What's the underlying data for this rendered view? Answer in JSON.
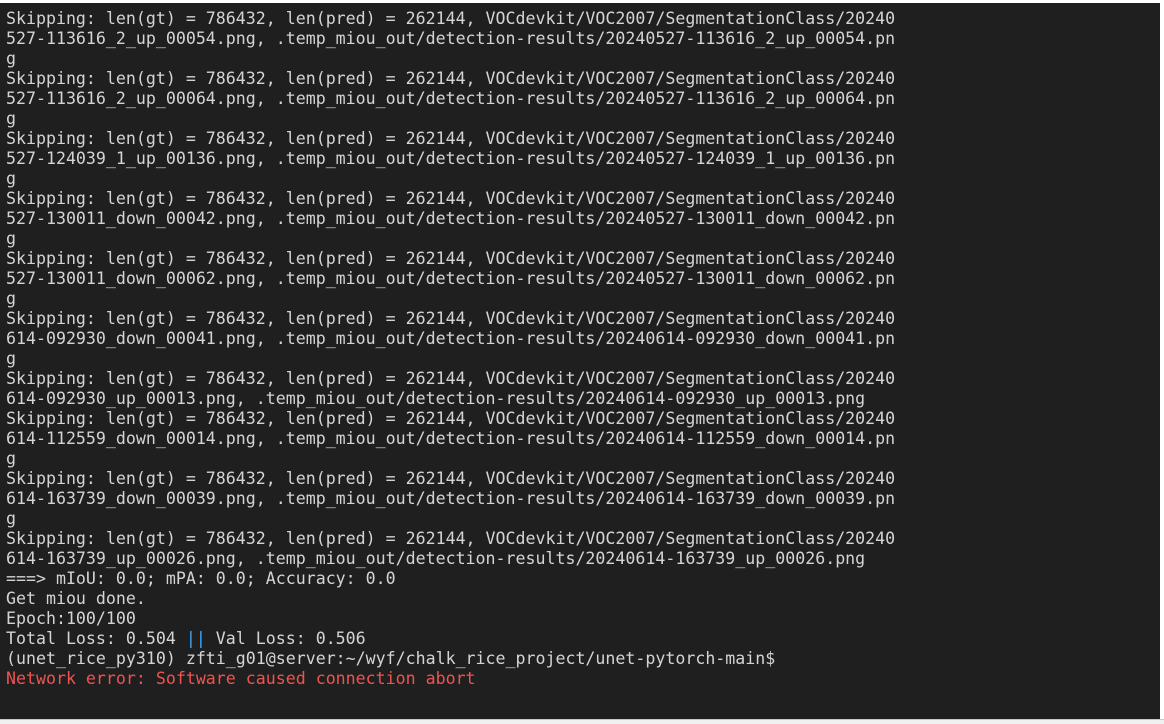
{
  "terminal": {
    "lines": [
      "Skipping: len(gt) = 786432, len(pred) = 262144, VOCdevkit/VOC2007/SegmentationClass/20240",
      "527-113616_2_up_00054.png, .temp_miou_out/detection-results/20240527-113616_2_up_00054.pn",
      "g",
      "Skipping: len(gt) = 786432, len(pred) = 262144, VOCdevkit/VOC2007/SegmentationClass/20240",
      "527-113616_2_up_00064.png, .temp_miou_out/detection-results/20240527-113616_2_up_00064.pn",
      "g",
      "Skipping: len(gt) = 786432, len(pred) = 262144, VOCdevkit/VOC2007/SegmentationClass/20240",
      "527-124039_1_up_00136.png, .temp_miou_out/detection-results/20240527-124039_1_up_00136.pn",
      "g",
      "Skipping: len(gt) = 786432, len(pred) = 262144, VOCdevkit/VOC2007/SegmentationClass/20240",
      "527-130011_down_00042.png, .temp_miou_out/detection-results/20240527-130011_down_00042.pn",
      "g",
      "Skipping: len(gt) = 786432, len(pred) = 262144, VOCdevkit/VOC2007/SegmentationClass/20240",
      "527-130011_down_00062.png, .temp_miou_out/detection-results/20240527-130011_down_00062.pn",
      "g",
      "Skipping: len(gt) = 786432, len(pred) = 262144, VOCdevkit/VOC2007/SegmentationClass/20240",
      "614-092930_down_00041.png, .temp_miou_out/detection-results/20240614-092930_down_00041.pn",
      "g",
      "Skipping: len(gt) = 786432, len(pred) = 262144, VOCdevkit/VOC2007/SegmentationClass/20240",
      "614-092930_up_00013.png, .temp_miou_out/detection-results/20240614-092930_up_00013.png",
      "Skipping: len(gt) = 786432, len(pred) = 262144, VOCdevkit/VOC2007/SegmentationClass/20240",
      "614-112559_down_00014.png, .temp_miou_out/detection-results/20240614-112559_down_00014.pn",
      "g",
      "Skipping: len(gt) = 786432, len(pred) = 262144, VOCdevkit/VOC2007/SegmentationClass/20240",
      "614-163739_down_00039.png, .temp_miou_out/detection-results/20240614-163739_down_00039.pn",
      "g",
      "Skipping: len(gt) = 786432, len(pred) = 262144, VOCdevkit/VOC2007/SegmentationClass/20240",
      "614-163739_up_00026.png, .temp_miou_out/detection-results/20240614-163739_up_00026.png",
      "===> mIoU: 0.0; mPA: 0.0; Accuracy: 0.0",
      "Get miou done.",
      "Epoch:100/100"
    ],
    "loss_line": {
      "total": "Total Loss: 0.504 ",
      "separator": "||",
      "val": " Val Loss: 0.506"
    },
    "prompt": "(unet_rice_py310) zfti_g01@server:~/wyf/chalk_rice_project/unet-pytorch-main$",
    "error": "Network error: Software caused connection abort",
    "colors": {
      "background": "#1f1f1f",
      "text": "#d4d4d4",
      "error": "#ef5350",
      "separator": "#42a5f5"
    }
  }
}
